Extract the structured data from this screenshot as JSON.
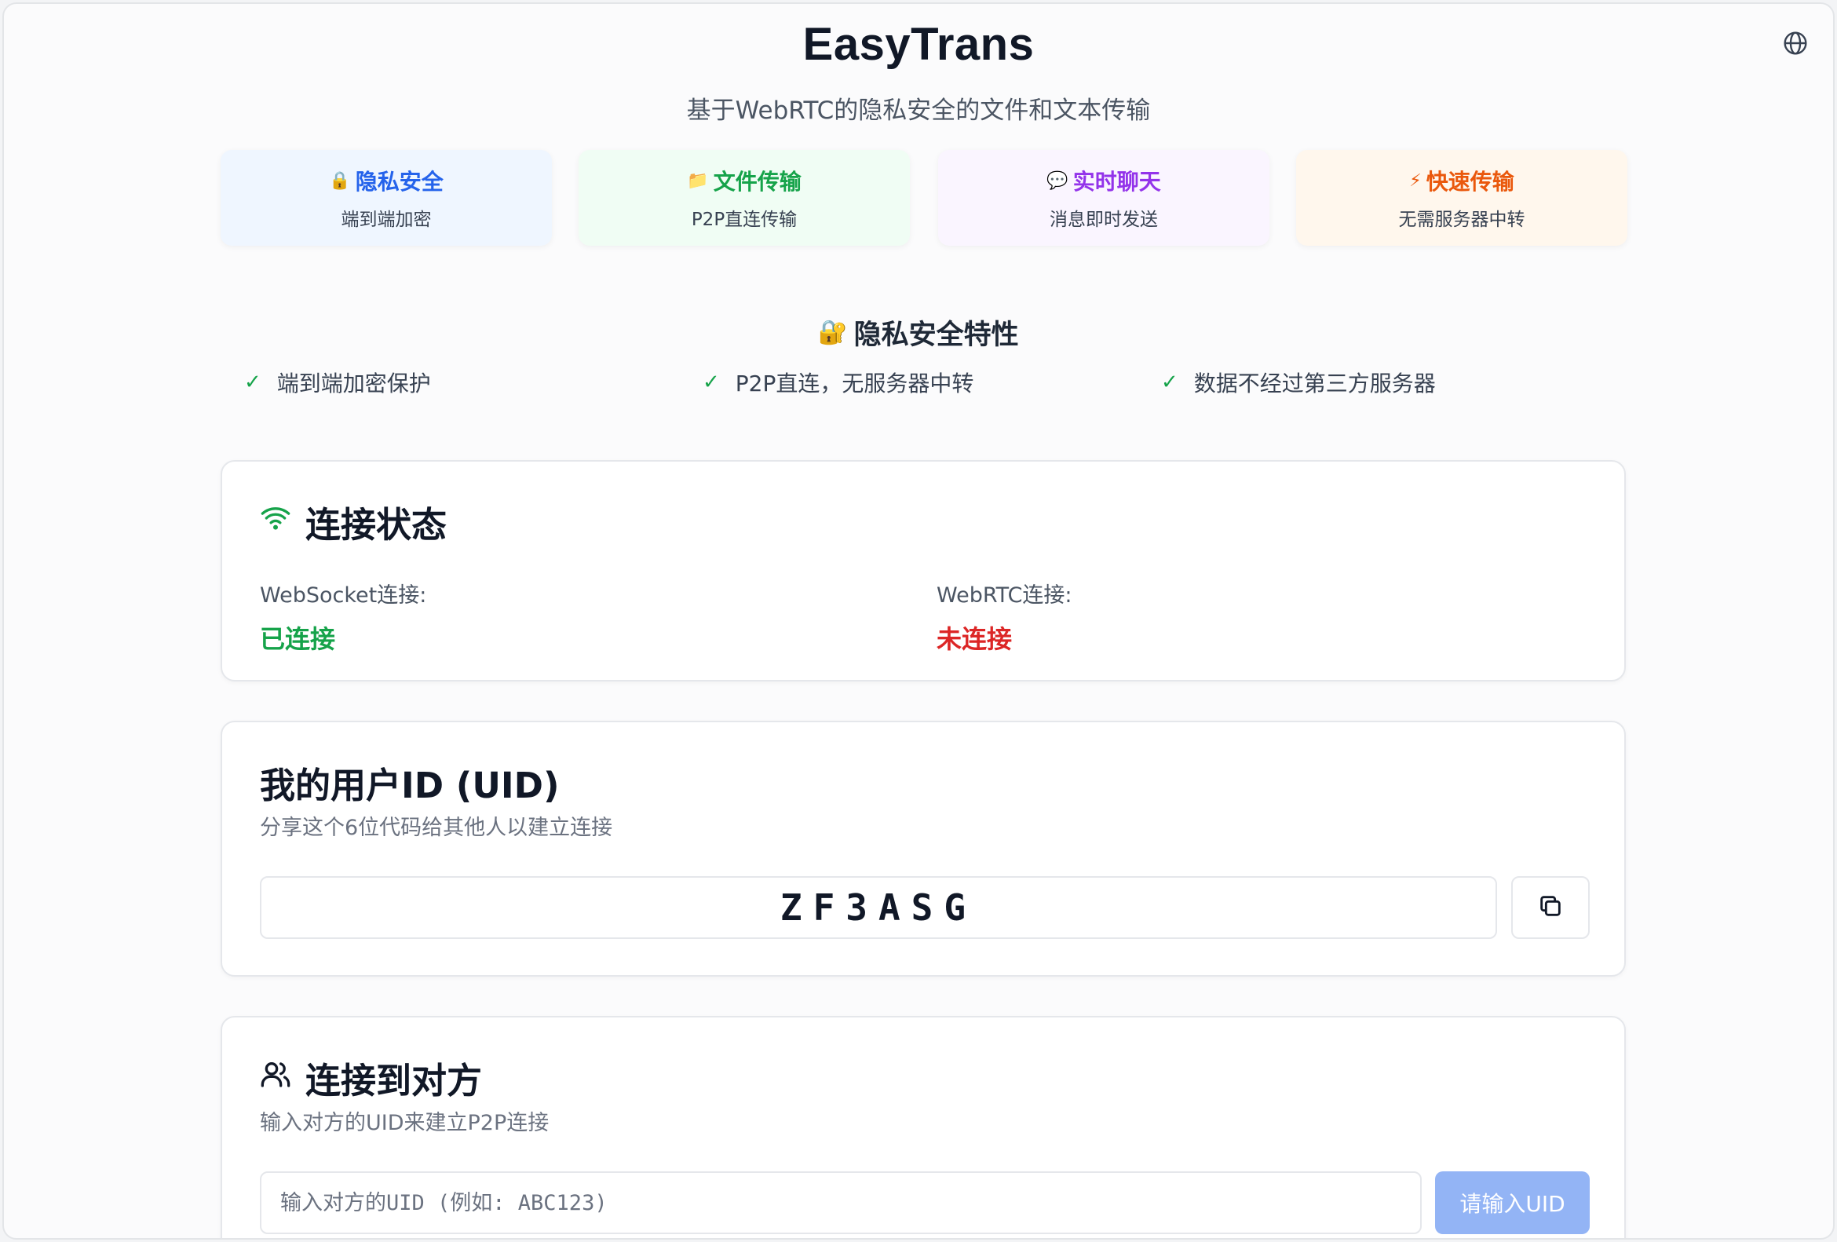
{
  "app": {
    "title": "EasyTrans",
    "subtitle": "基于WebRTC的隐私安全的文件和文本传输"
  },
  "features": [
    {
      "icon": "🔒",
      "title": "隐私安全",
      "desc": "端到端加密"
    },
    {
      "icon": "📁",
      "title": "文件传输",
      "desc": "P2P直连传输"
    },
    {
      "icon": "💬",
      "title": "实时聊天",
      "desc": "消息即时发送"
    },
    {
      "icon": "⚡",
      "title": "快速传输",
      "desc": "无需服务器中转"
    }
  ],
  "privacy_section": {
    "icon": "🔐",
    "heading": "隐私安全特性",
    "items": [
      "端到端加密保护",
      "P2P直连，无服务器中转",
      "数据不经过第三方服务器"
    ],
    "check_glyph": "✓"
  },
  "connection_status": {
    "title": "连接状态",
    "websocket_label": "WebSocket连接:",
    "websocket_value": "已连接",
    "webrtc_label": "WebRTC连接:",
    "webrtc_value": "未连接"
  },
  "my_uid": {
    "title": "我的用户ID (UID)",
    "subtitle": "分享这个6位代码给其他人以建立连接",
    "uid": "ZF3ASG"
  },
  "connect_peer": {
    "title": "连接到对方",
    "subtitle": "输入对方的UID来建立P2P连接",
    "input_value": "",
    "input_placeholder": "输入对方的UID (例如: ABC123)",
    "button_label": "请输入UID"
  },
  "colors": {
    "accent_blue": "#2563eb",
    "success": "#16a34a",
    "danger": "#dc2626",
    "purple": "#9333ea",
    "orange": "#ea580c",
    "button_disabled": "#93b4f5"
  }
}
